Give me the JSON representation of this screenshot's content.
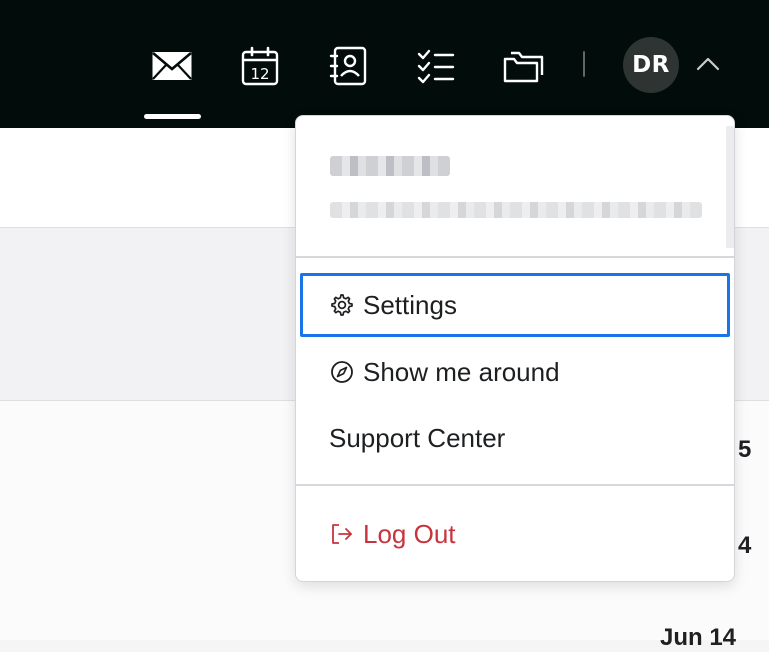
{
  "topbar": {
    "nav": [
      {
        "name": "mail",
        "icon": "mail-icon",
        "active": true
      },
      {
        "name": "calendar",
        "icon": "calendar-icon",
        "day": "12"
      },
      {
        "name": "contacts",
        "icon": "contacts-icon"
      },
      {
        "name": "tasks",
        "icon": "tasks-icon"
      },
      {
        "name": "files",
        "icon": "folders-icon"
      }
    ],
    "avatar_initials": "DR",
    "chevron_icon": "chevron-up-icon"
  },
  "background": {
    "list_dates": [
      "5",
      "4",
      "Jun 14"
    ]
  },
  "dropdown": {
    "items": [
      {
        "label": "Settings",
        "icon": "gear-icon",
        "focused": true
      },
      {
        "label": "Show me around",
        "icon": "compass-icon"
      },
      {
        "label": "Support Center"
      },
      {
        "label": "Log Out",
        "icon": "logout-icon",
        "danger": true
      }
    ]
  },
  "colors": {
    "topbar": "#020c0a",
    "focus_ring": "#1a73e8",
    "danger": "#c8343e"
  }
}
